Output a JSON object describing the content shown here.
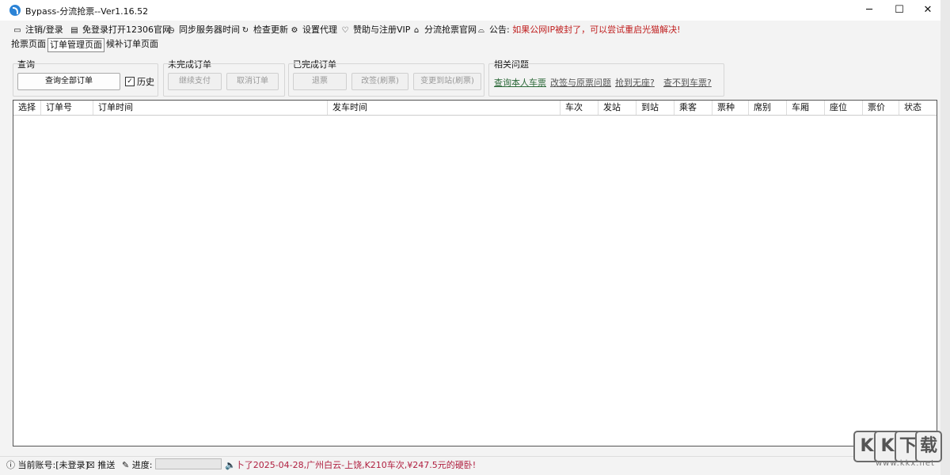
{
  "window": {
    "title": "Bypass-分流抢票--Ver1.16.52"
  },
  "menu": [
    {
      "icon": "monitor-icon",
      "label": "注销/登录"
    },
    {
      "icon": "browser-icon",
      "label": "免登录打开12306官网"
    },
    {
      "icon": "clock-icon",
      "label": "同步服务器时间"
    },
    {
      "icon": "refresh-icon",
      "label": "检查更新"
    },
    {
      "icon": "gear-icon",
      "label": "设置代理"
    },
    {
      "icon": "heart-icon",
      "label": "赞助与注册VIP"
    },
    {
      "icon": "home-icon",
      "label": "分流抢票官网"
    },
    {
      "icon": "announcement-icon",
      "label": "公告:",
      "text": "如果公网IP被封了，可以尝试重启光猫解决!"
    }
  ],
  "tabs": [
    {
      "label": "抢票页面",
      "active": false
    },
    {
      "label": "订单管理页面",
      "active": true
    },
    {
      "label": "候补订单页面",
      "active": false
    }
  ],
  "query": {
    "label": "查询",
    "query_all_button": "查询全部订单",
    "history_checked": true,
    "history_label": "历史"
  },
  "incomplete": {
    "label": "未完成订单",
    "continue_pay": "继续支付",
    "cancel_order": "取消订单"
  },
  "completed": {
    "label": "已完成订单",
    "refund": "退票",
    "change_sign": "改签(刷票)",
    "change_station": "变更到站(刷票)"
  },
  "related": {
    "label": "相关问题",
    "links": [
      "查询本人车票",
      "改签与原票问题",
      "抢到无座?",
      "查不到车票?"
    ]
  },
  "table": {
    "columns": [
      "选择",
      "订单号",
      "订单时间",
      "发车时间",
      "车次",
      "发站",
      "到站",
      "乘客",
      "票种",
      "席别",
      "车厢",
      "座位",
      "票价",
      "状态"
    ]
  },
  "status": {
    "account": "当前账号:[未登录]",
    "push": "推送",
    "progress_label": "进度:",
    "progress_value": 0,
    "ticker": "卜了2025-04-28,广州白云-上饶,K210车次,¥247.5元的硬卧!"
  },
  "watermark": {
    "chars": [
      "K",
      "K",
      "下",
      "载"
    ],
    "url": "www.kkx.net"
  },
  "colors": {
    "accent": "#2b83d6",
    "notice": "#c02020",
    "ticker": "#b02040"
  }
}
